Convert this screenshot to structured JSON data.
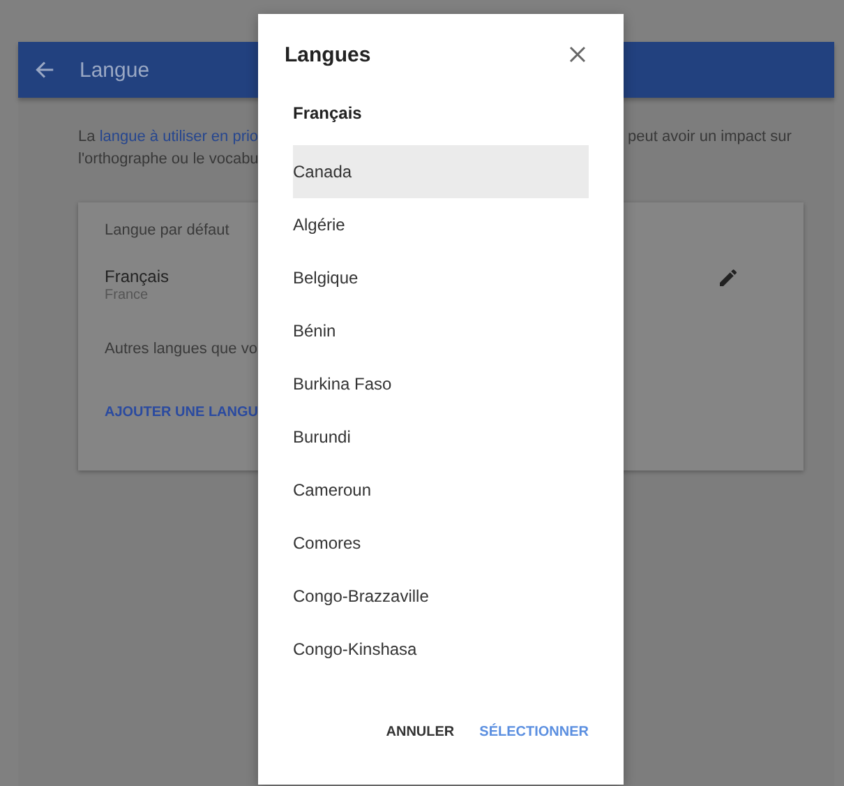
{
  "page": {
    "header": {
      "title": "Langue"
    },
    "intro": {
      "left_lines": [
        [
          {
            "kind": "plain",
            "text": "La"
          },
          {
            "kind": "link",
            "text": "langue à utiliser en prio"
          }
        ],
        [
          {
            "kind": "plain",
            "text": "l'orthographe ou le vocabu"
          }
        ]
      ],
      "right_lines": [
        "peut avoir un impact sur"
      ]
    },
    "card": {
      "default_heading": "Langue par défaut",
      "language": "Français",
      "region": "France",
      "others_heading": "Autres langues que vo",
      "add_link": "AJOUTER UNE LANGU"
    }
  },
  "dialog": {
    "title": "Langues",
    "group": "Français",
    "items": [
      {
        "label": "Canada",
        "selected": true
      },
      {
        "label": "Algérie",
        "selected": false
      },
      {
        "label": "Belgique",
        "selected": false
      },
      {
        "label": "Bénin",
        "selected": false
      },
      {
        "label": "Burkina Faso",
        "selected": false
      },
      {
        "label": "Burundi",
        "selected": false
      },
      {
        "label": "Cameroun",
        "selected": false
      },
      {
        "label": "Comores",
        "selected": false
      },
      {
        "label": "Congo-Brazzaville",
        "selected": false
      },
      {
        "label": "Congo-Kinshasa",
        "selected": false
      }
    ],
    "buttons": [
      {
        "label": "ANNULER",
        "kind": "secondary"
      },
      {
        "label": "SÉLECTIONNER",
        "kind": "primary"
      }
    ]
  }
}
